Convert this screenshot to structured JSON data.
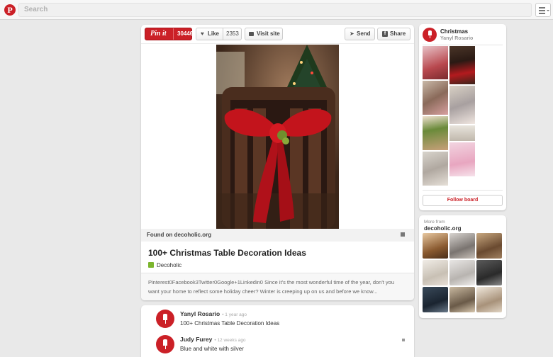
{
  "header": {
    "search_placeholder": "Search",
    "logo": "pinterest-logo"
  },
  "pin": {
    "pinit_label": "Pin it",
    "pinit_count": "30446",
    "like_label": "Like",
    "like_count": "2353",
    "visit_label": "Visit site",
    "send_label": "Send",
    "share_label": "Share",
    "found_on": "Found on decoholic.org",
    "title": "100+ Christmas Table Decoration Ideas",
    "source_name": "Decoholic",
    "description": "Pinterest0Facebook3Twitter0Google+1Linkedin0 Since it's the most wonderful time of the year, don't you want your home to reflect some holiday cheer? Winter is creeping up on us and before we know..."
  },
  "comments": [
    {
      "name": "Yanyl Rosario",
      "time": "• 1 year ago",
      "text": "100+ Christmas Table Decoration Ideas"
    },
    {
      "name": "Judy Furey",
      "time": "• 12 weeks ago",
      "text": "Blue and white with silver"
    }
  ],
  "board": {
    "title": "Christmas",
    "owner": "Yanyl Rosario",
    "follow_label": "Follow board"
  },
  "more_from": {
    "label": "More from",
    "source": "decoholic.org"
  },
  "colors": {
    "brand": "#cb2027",
    "background": "#e9e9e9"
  }
}
